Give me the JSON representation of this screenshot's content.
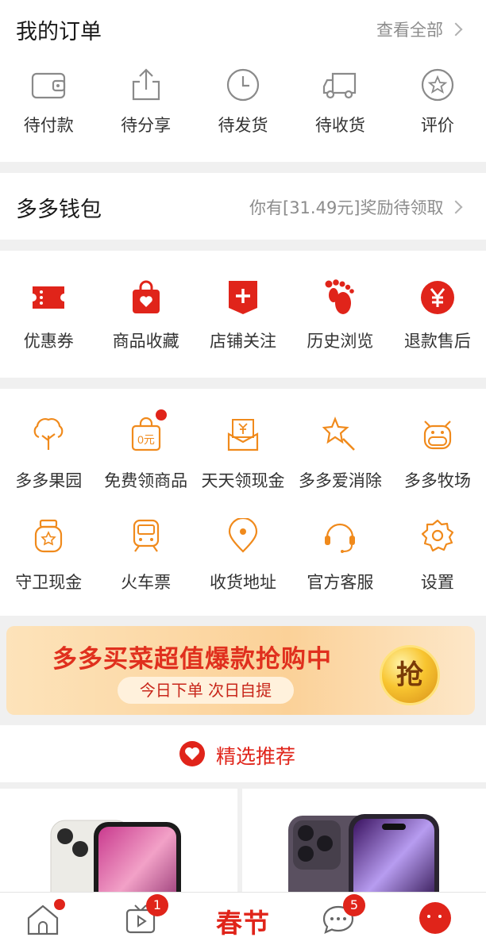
{
  "orders": {
    "title": "我的订单",
    "view_all": "查看全部",
    "items": [
      {
        "label": "待付款",
        "icon": "wallet-icon"
      },
      {
        "label": "待分享",
        "icon": "share-icon"
      },
      {
        "label": "待发货",
        "icon": "clock-icon"
      },
      {
        "label": "待收货",
        "icon": "truck-icon"
      },
      {
        "label": "评价",
        "icon": "star-bubble-icon"
      }
    ]
  },
  "wallet": {
    "title": "多多钱包",
    "reward_text": "你有[31.49元]奖励待领取"
  },
  "shortcuts": {
    "items": [
      {
        "label": "优惠券",
        "icon": "coupon-icon"
      },
      {
        "label": "商品收藏",
        "icon": "shopping-bag-heart-icon"
      },
      {
        "label": "店铺关注",
        "icon": "shop-plus-icon"
      },
      {
        "label": "历史浏览",
        "icon": "footprint-icon"
      },
      {
        "label": "退款售后",
        "icon": "yen-circle-icon"
      }
    ]
  },
  "services": {
    "row1": [
      {
        "label": "多多果园",
        "icon": "tree-icon"
      },
      {
        "label": "免费领商品",
        "icon": "free-bag-icon",
        "icon_text": "0元"
      },
      {
        "label": "天天领现金",
        "icon": "cash-envelope-icon"
      },
      {
        "label": "多多爱消除",
        "icon": "star-wand-icon"
      },
      {
        "label": "多多牧场",
        "icon": "cow-icon"
      }
    ],
    "row2": [
      {
        "label": "守卫现金",
        "icon": "jar-icon"
      },
      {
        "label": "火车票",
        "icon": "train-icon"
      },
      {
        "label": "收货地址",
        "icon": "location-icon"
      },
      {
        "label": "官方客服",
        "icon": "headset-icon"
      },
      {
        "label": "设置",
        "icon": "gear-icon"
      }
    ]
  },
  "banner": {
    "headline": "多多买菜超值爆款抢购中",
    "sub": "今日下单 次日自提",
    "coin": "抢"
  },
  "recommend": {
    "label": "精选推荐"
  },
  "tabbar": {
    "center_label": "春节",
    "video_badge": "1",
    "chat_badge": "5"
  },
  "colors": {
    "accent_red": "#e0241a",
    "service_orange": "#f08a1c",
    "text_gray": "#8c8c8c"
  }
}
